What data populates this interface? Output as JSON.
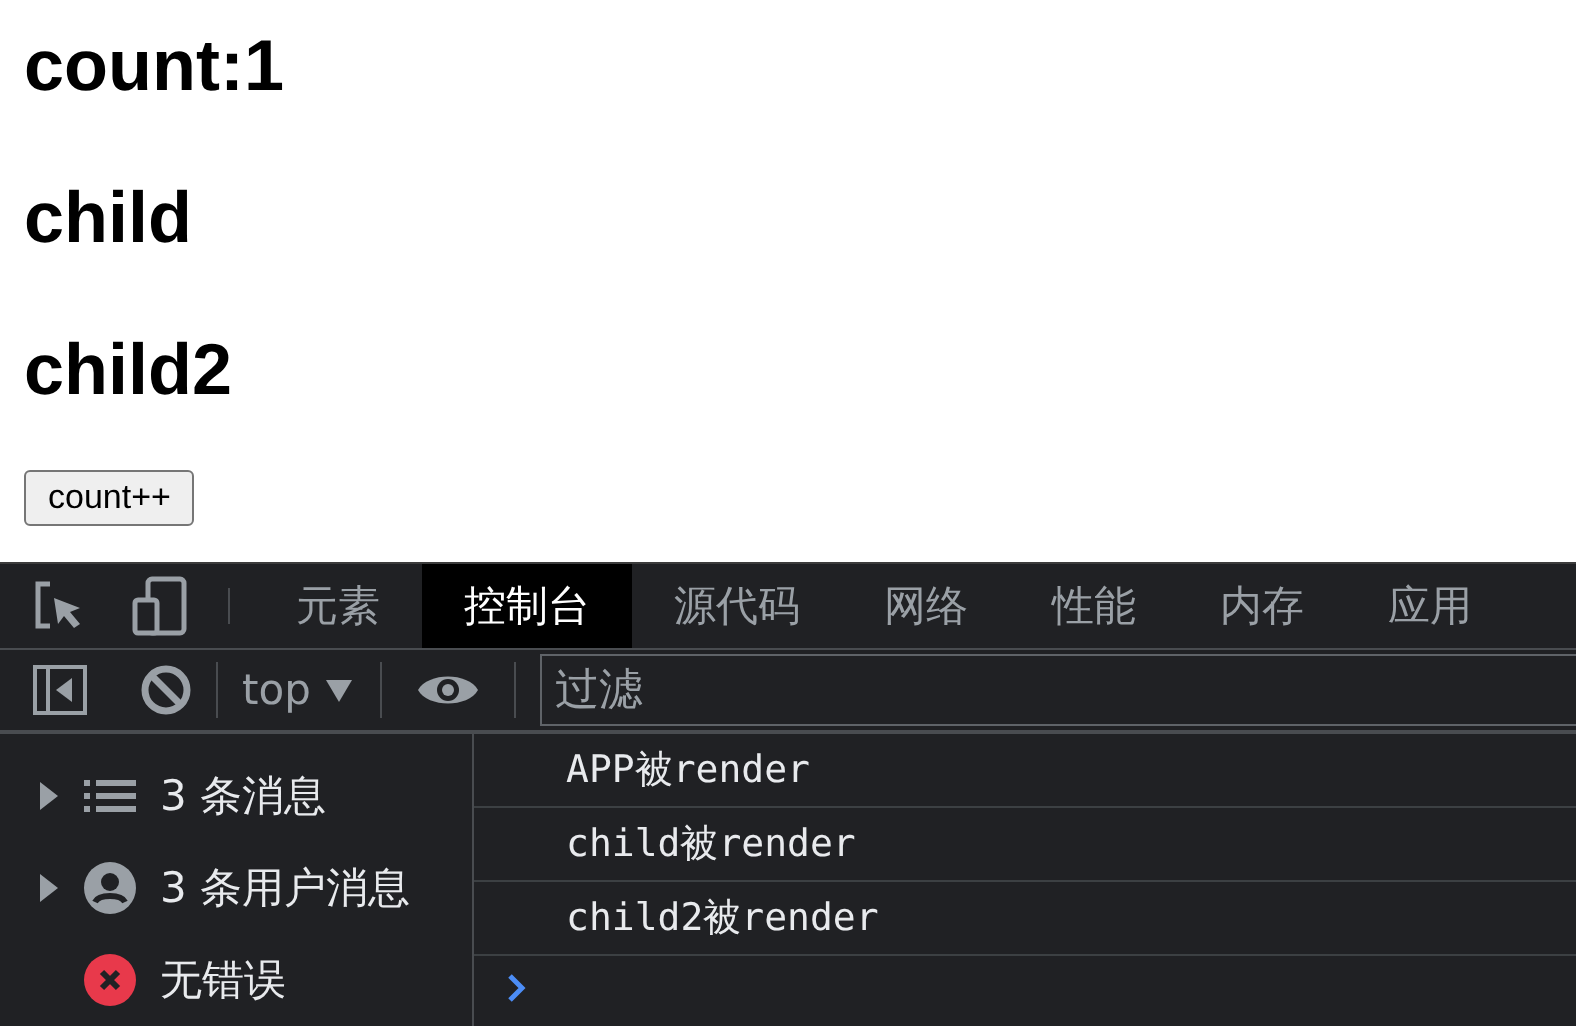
{
  "page": {
    "headings": [
      "count:1",
      "child",
      "child2"
    ],
    "button": "count++"
  },
  "devtools": {
    "tabs": [
      {
        "label": "元素",
        "selected": false
      },
      {
        "label": "控制台",
        "selected": true
      },
      {
        "label": "源代码",
        "selected": false
      },
      {
        "label": "网络",
        "selected": false
      },
      {
        "label": "性能",
        "selected": false
      },
      {
        "label": "内存",
        "selected": false
      },
      {
        "label": "应用",
        "selected": false
      }
    ],
    "toolbar": {
      "context": "top",
      "filter": {
        "placeholder": "过滤"
      }
    },
    "sidebar": [
      {
        "kind": "messages",
        "label": "3 条消息",
        "expandable": true
      },
      {
        "kind": "user",
        "label": "3 条用户消息",
        "expandable": true
      },
      {
        "kind": "error",
        "label": "无错误",
        "expandable": false
      }
    ],
    "console": {
      "messages": [
        "APP被render",
        "child被render",
        "child2被render"
      ]
    }
  }
}
